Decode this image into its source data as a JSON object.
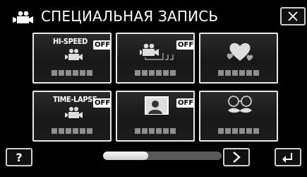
{
  "header": {
    "title": "СПЕЦИАЛЬНАЯ ЗАПИСЬ",
    "icon": "movie-camera-mode-icon",
    "close_icon": "close-x-icon"
  },
  "tiles": [
    {
      "label": "HI-SPEED",
      "badge": "OFF",
      "icon": "slow-motion-camera-icon",
      "name_placeholder": "▪▪▪▪▪▪"
    },
    {
      "label": "",
      "badge": "OFF",
      "icon": "interval-camera-icon",
      "name_placeholder": "▪▪▪▪▪▪"
    },
    {
      "label": "",
      "badge": "",
      "icon": "hearts-icon",
      "name_placeholder": "▪▪▪▪▪▪"
    },
    {
      "label": "TIME-LAPSE",
      "badge": "OFF",
      "icon": "time-lapse-camera-icon",
      "name_placeholder": "▪▪▪▪▪▪"
    },
    {
      "label": "",
      "badge": "OFF",
      "icon": "portrait-frame-icon",
      "name_placeholder": "▪▪▪▪▪▪"
    },
    {
      "label": "",
      "badge": "",
      "icon": "glasses-mustache-icon",
      "name_placeholder": "▪▪▪▪▪▪"
    }
  ],
  "footer": {
    "help_label": "?",
    "next_icon": "chevron-right-icon",
    "back_icon": "return-arrow-icon",
    "scroll_position": 0.38
  }
}
